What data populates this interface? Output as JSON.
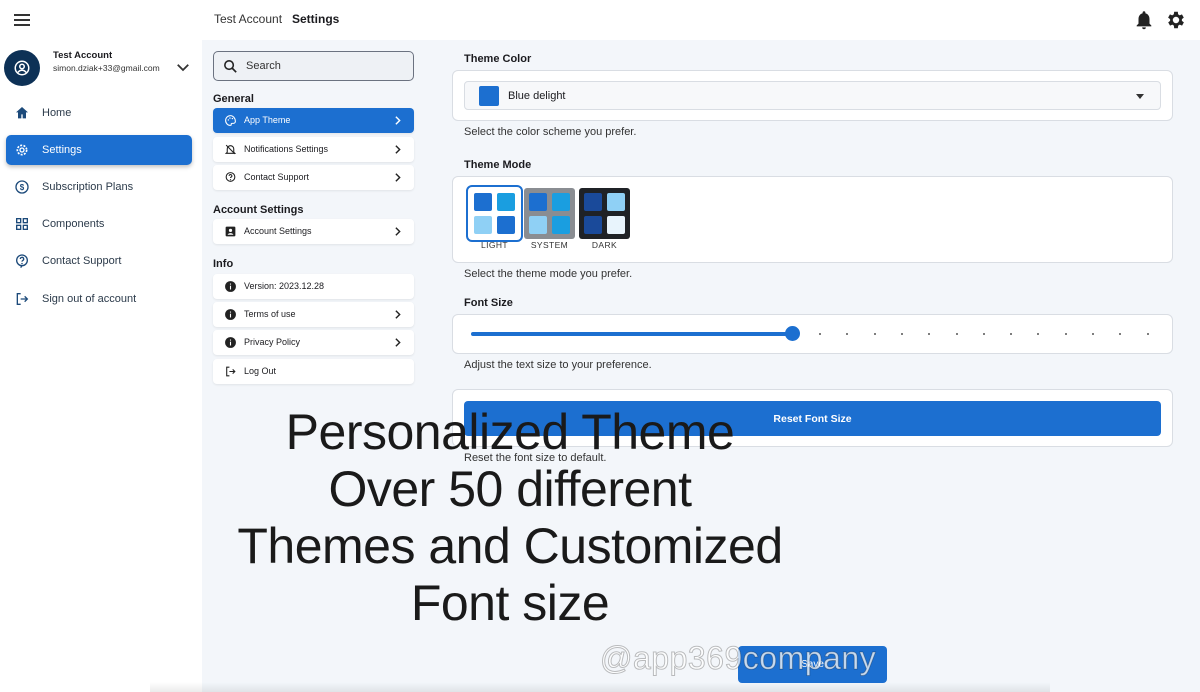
{
  "breadcrumb": {
    "account": "Test Account",
    "current": "Settings"
  },
  "account": {
    "name": "Test Account",
    "email": "simon.dziak+33@gmail.com"
  },
  "sidebar": {
    "items": [
      {
        "label": "Home",
        "icon": "home-icon"
      },
      {
        "label": "Settings",
        "icon": "gear-icon",
        "active": true
      },
      {
        "label": "Subscription Plans",
        "icon": "dollar-circle-icon"
      },
      {
        "label": "Components",
        "icon": "grid-icon"
      },
      {
        "label": "Contact Support",
        "icon": "help-icon"
      },
      {
        "label": "Sign out of account",
        "icon": "logout-icon"
      }
    ]
  },
  "settings_list": {
    "search_placeholder": "Search",
    "general_heading": "General",
    "app_theme": "App Theme",
    "notifications": "Notifications Settings",
    "contact_support": "Contact Support",
    "account_heading": "Account Settings",
    "account_settings": "Account Settings",
    "info_heading": "Info",
    "version": "Version: 2023.12.28",
    "terms": "Terms of use",
    "privacy": "Privacy Policy",
    "logout": "Log Out"
  },
  "theme_color": {
    "heading": "Theme Color",
    "value": "Blue delight",
    "swatch": "#1c6fd0",
    "help": "Select the color scheme you prefer."
  },
  "theme_mode": {
    "heading": "Theme Mode",
    "options": [
      "LIGHT",
      "SYSTEM",
      "DARK"
    ],
    "selected": "LIGHT",
    "help": "Select the theme mode you prefer."
  },
  "font_size": {
    "heading": "Font Size",
    "level": 0.47,
    "help": "Adjust the text size to your preference."
  },
  "reset": {
    "button": "Reset Font Size",
    "help": "Reset the font size to default."
  },
  "save_button": "Save",
  "overlay": {
    "line1": "Personalized Theme",
    "line2": "Over 50 different",
    "line3": "Themes and Customized",
    "line4": "Font size"
  },
  "watermark": "@app369company",
  "colors": {
    "accent": "#1c6fd0",
    "navy": "#0d3156"
  }
}
